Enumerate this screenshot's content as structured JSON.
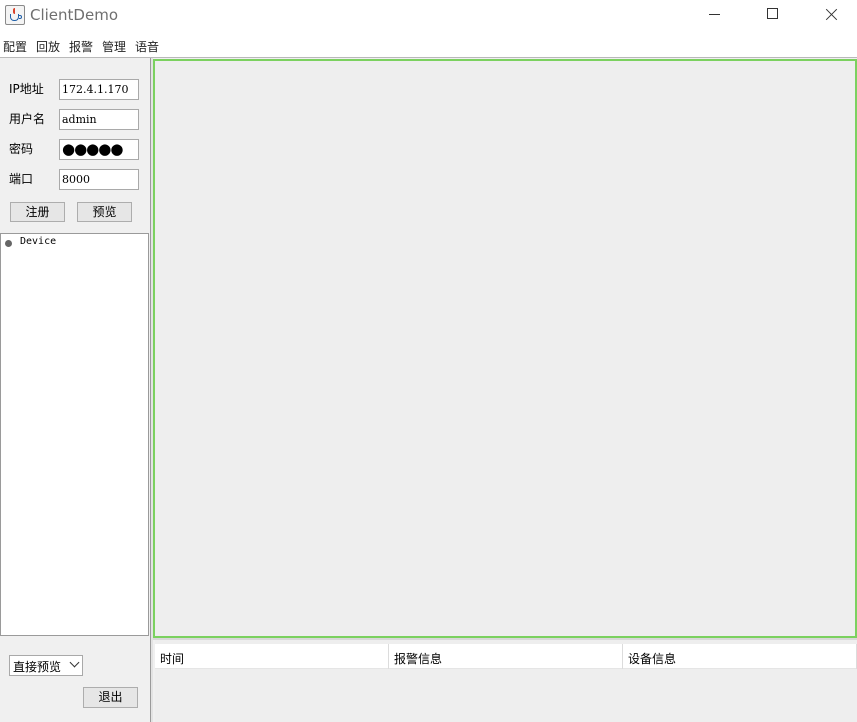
{
  "window": {
    "title": "ClientDemo"
  },
  "menu": [
    "配置",
    "回放",
    "报警",
    "管理",
    "语音"
  ],
  "login": {
    "ip_label": "IP地址",
    "ip_value": "172.4.1.170",
    "user_label": "用户名",
    "user_value": "admin",
    "password_label": "密码",
    "password_value": "●●●●●",
    "port_label": "端口",
    "port_value": "8000",
    "register_label": "注册",
    "preview_label": "预览"
  },
  "tree": {
    "root_label": "Device"
  },
  "bottom": {
    "mode_selected": "直接预览",
    "exit_label": "退出"
  },
  "alarm_table": {
    "columns": [
      "时间",
      "报警信息",
      "设备信息"
    ]
  },
  "colors": {
    "preview_border": "#7bd15f",
    "background": "#f0f0f0"
  }
}
